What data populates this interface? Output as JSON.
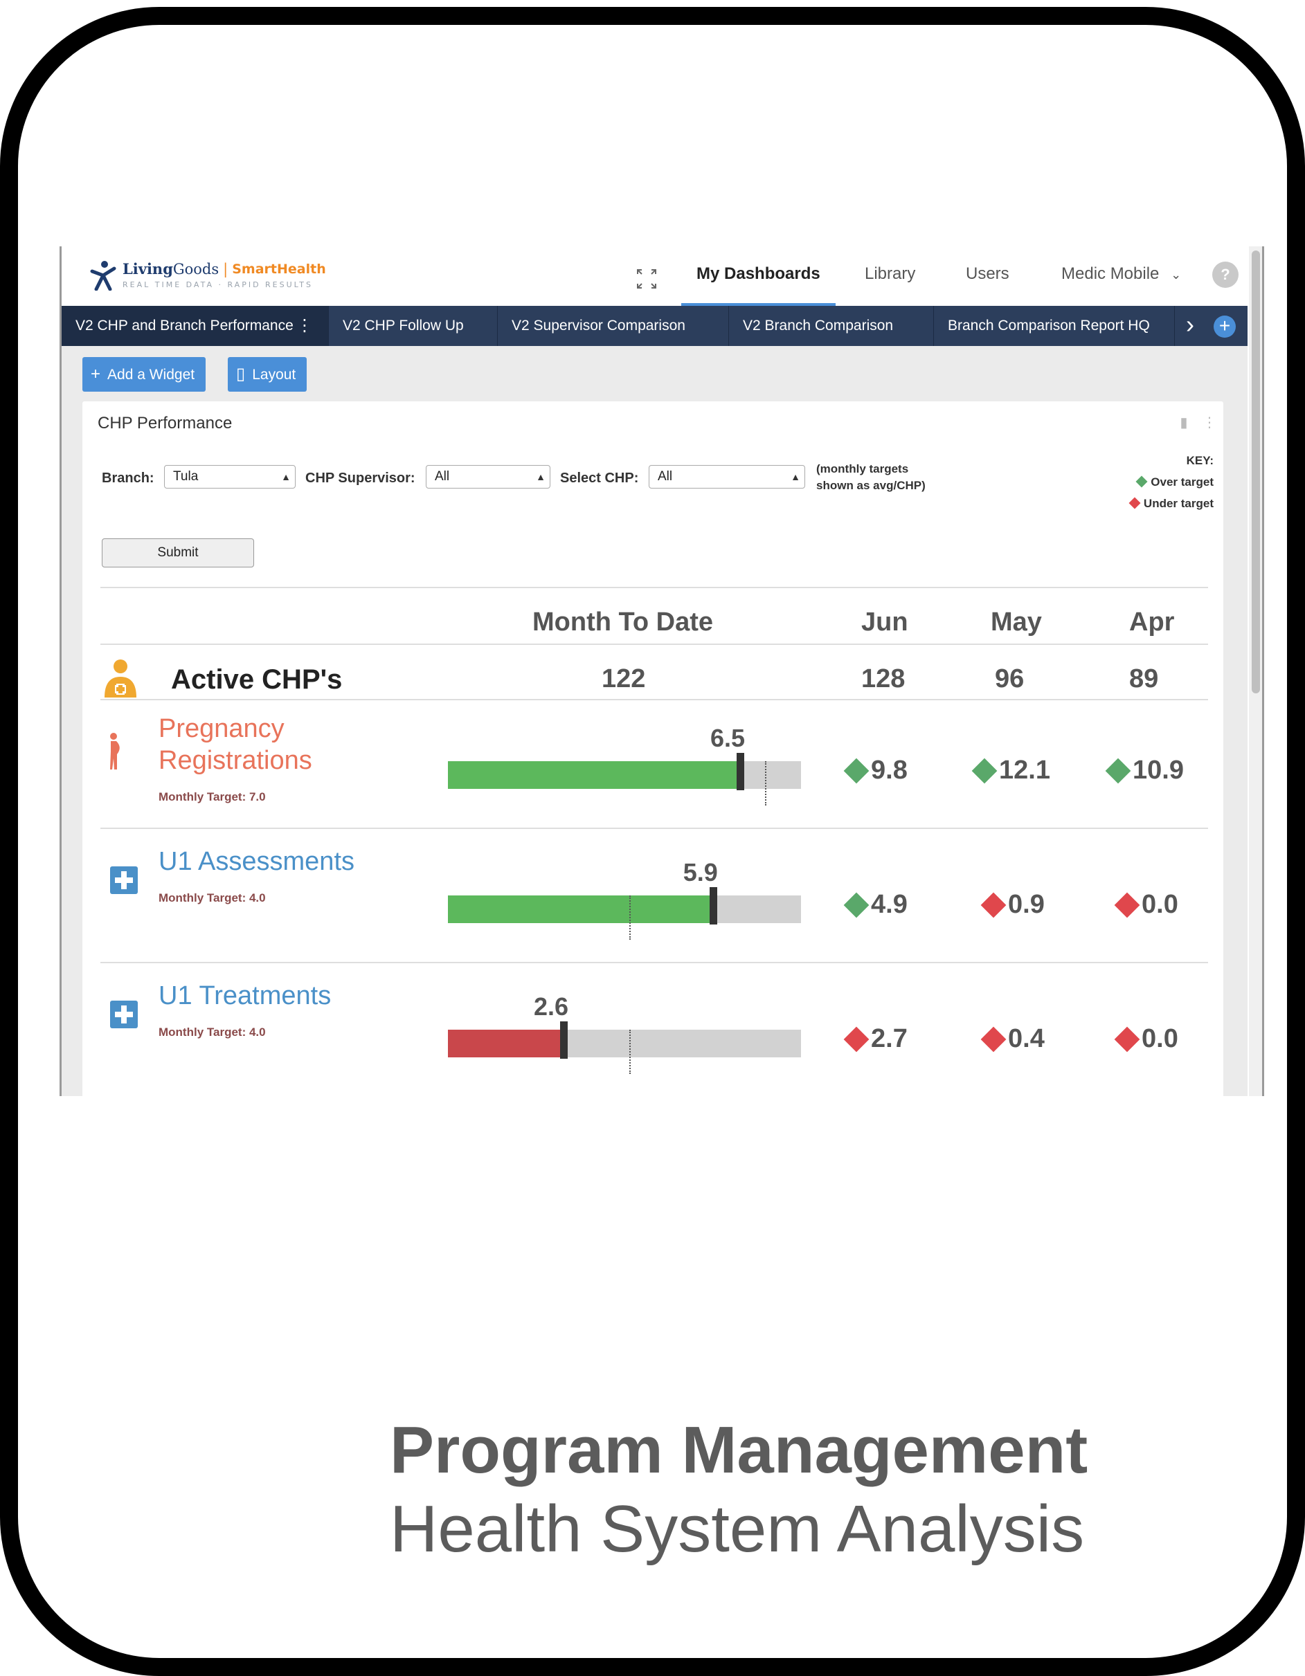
{
  "app": {
    "logo": {
      "brand_a": "Living",
      "brand_b": "Goods",
      "sep": "|",
      "brand_c": "SmartHealth",
      "tagline": "REAL TIME DATA · RAPID RESULTS"
    },
    "nav": {
      "my_dashboards": "My Dashboards",
      "library": "Library",
      "users": "Users",
      "org": "Medic Mobile",
      "help": "?"
    }
  },
  "tabs": [
    {
      "label": "V2 CHP and Branch Performance",
      "active": true
    },
    {
      "label": "V2 CHP Follow Up",
      "active": false
    },
    {
      "label": "V2 Supervisor Comparison",
      "active": false
    },
    {
      "label": "V2 Branch Comparison",
      "active": false
    },
    {
      "label": "Branch Comparison Report HQ",
      "active": false
    }
  ],
  "toolbar": {
    "add_widget": "Add a Widget",
    "layout": "Layout"
  },
  "widget": {
    "title": "CHP Performance",
    "filters": {
      "branch_label": "Branch:",
      "branch_value": "Tula",
      "supervisor_label": "CHP Supervisor:",
      "supervisor_value": "All",
      "chp_label": "Select CHP:",
      "chp_value": "All",
      "note_line1": "(monthly targets",
      "note_line2": "shown as avg/CHP)"
    },
    "key": {
      "title": "KEY:",
      "over": "Over target",
      "under": "Under target",
      "over_color": "#5aa86a",
      "under_color": "#e0474c"
    },
    "submit": "Submit",
    "columns": {
      "mtd": "Month To Date",
      "m1": "Jun",
      "m2": "May",
      "m3": "Apr"
    },
    "active_chps": {
      "label": "Active CHP's",
      "mtd": "122",
      "m1": "128",
      "m2": "96",
      "m3": "89"
    },
    "metrics": [
      {
        "name_line1": "Pregnancy",
        "name_line2": "Registrations",
        "name_color": "#e8735a",
        "target_text": "Monthly Target: 7.0",
        "target": 7.0,
        "value": 6.5,
        "value_label": "6.5",
        "status": "under",
        "bar_color": "#5cb85c",
        "history": [
          {
            "value": "9.8",
            "status": "over"
          },
          {
            "value": "12.1",
            "status": "over"
          },
          {
            "value": "10.9",
            "status": "over"
          }
        ]
      },
      {
        "name_line1": "U1 Assessments",
        "name_line2": "",
        "name_color": "#4a90c8",
        "target_text": "Monthly Target: 4.0",
        "target": 4.0,
        "value": 5.9,
        "value_label": "5.9",
        "status": "over",
        "bar_color": "#5cb85c",
        "history": [
          {
            "value": "4.9",
            "status": "over"
          },
          {
            "value": "0.9",
            "status": "under"
          },
          {
            "value": "0.0",
            "status": "under"
          }
        ]
      },
      {
        "name_line1": "U1 Treatments",
        "name_line2": "",
        "name_color": "#4a90c8",
        "target_text": "Monthly Target: 4.0",
        "target": 4.0,
        "value": 2.6,
        "value_label": "2.6",
        "status": "under",
        "bar_color": "#c9474b",
        "history": [
          {
            "value": "2.7",
            "status": "under"
          },
          {
            "value": "0.4",
            "status": "under"
          },
          {
            "value": "0.0",
            "status": "under"
          }
        ]
      }
    ]
  },
  "caption": {
    "title": "Program Management",
    "subtitle": "Health System Analysis"
  }
}
